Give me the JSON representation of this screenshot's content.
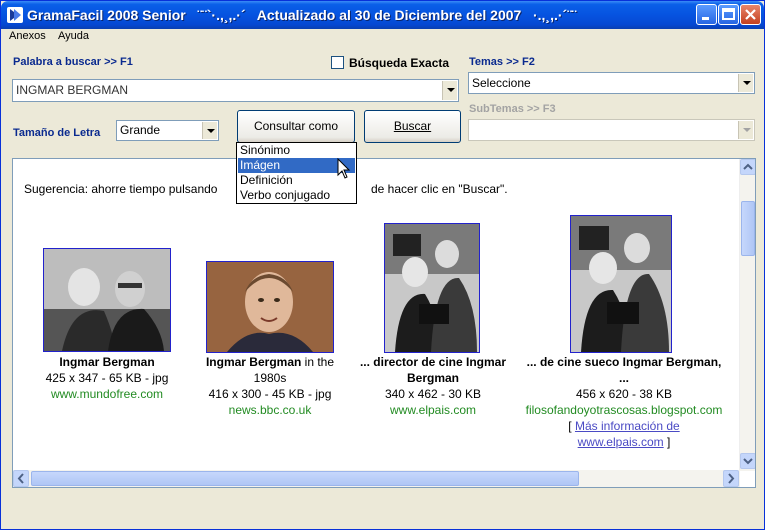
{
  "window": {
    "title": "GramaFacil 2008 Senior   ¨¨`·.,¸,.·´   Actualizado al 30 de Diciembre del 2007   ·.,¸,.·´¨¨",
    "accent": "#0653E0"
  },
  "menu": {
    "items": [
      "Anexos",
      "Ayuda"
    ]
  },
  "search": {
    "label": "Palabra a buscar >> F1",
    "value": "INGMAR BERGMAN",
    "exact_label": "Búsqueda Exacta",
    "exact_checked": false
  },
  "topics": {
    "label": "Temas >> F2",
    "value": "Seleccione",
    "sub_label": "SubTemas >> F3",
    "sub_value": ""
  },
  "font_size": {
    "label": "Tamaño de Letra",
    "value": "Grande"
  },
  "buttons": {
    "consult": "Consultar como",
    "search": "Buscar"
  },
  "consult_menu": {
    "options": [
      "Sinónimo",
      "Imágen",
      "Definición",
      "Verbo conjugado"
    ],
    "selected": "Imágen"
  },
  "results": {
    "tip_start": "Sugerencia: ahorre tiempo pulsando",
    "tip_end": "de hacer clic en \"Buscar\".",
    "images": [
      {
        "title_pre": "",
        "title_bold": "Ingmar Bergman",
        "title_post": "",
        "title_line2": "",
        "meta": "425 x 347 - 65 KB - jpg",
        "source": "www.mundofree.com"
      },
      {
        "title_pre": "",
        "title_bold": "Ingmar Bergman",
        "title_post": " in the",
        "title_line2": "1980s",
        "meta": "416 x 300 - 45 KB - jpg",
        "source": "news.bbc.co.uk"
      },
      {
        "title_pre": "... director de cine ",
        "title_bold": "Ingmar",
        "title_post": "",
        "title_line2": "Bergman",
        "meta": "340 x 462 - 30 KB",
        "source": "www.elpais.com"
      },
      {
        "title_pre": "... de cine sueco ",
        "title_bold": "Ingmar Bergman",
        "title_post": ",",
        "title_line2": "...",
        "meta": "456 x 620 - 38 KB",
        "source": "filosofandoyotrascosas.blogspot.com"
      }
    ],
    "more_open": "[ ",
    "more_link": "Más información de",
    "more_link2": "www.elpais.com",
    "more_close": " ]"
  }
}
